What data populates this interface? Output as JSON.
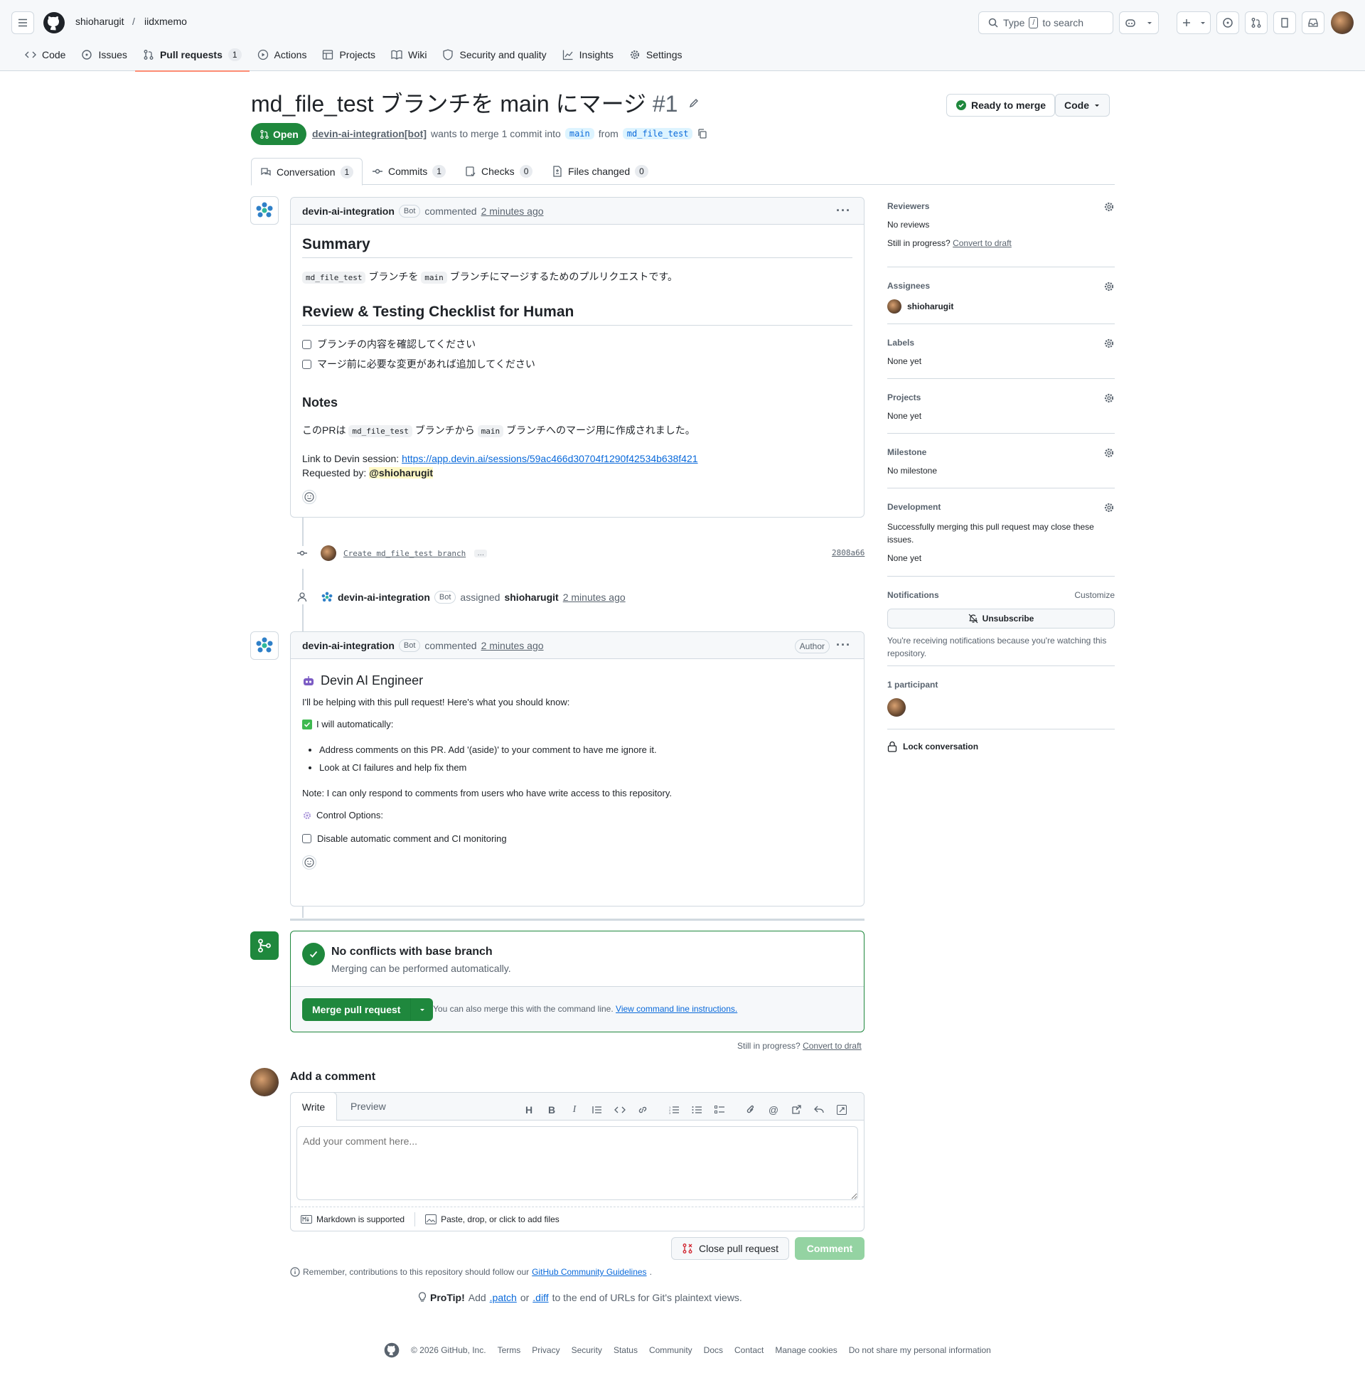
{
  "header": {
    "owner": "shioharugit",
    "separator": "/",
    "repo": "iidxmemo",
    "search_type": "Type",
    "search_key": "/",
    "search_rest": "to search"
  },
  "nav": [
    {
      "label": "Code",
      "icon": "code-icon"
    },
    {
      "label": "Issues",
      "icon": "issue-opened-icon"
    },
    {
      "label": "Pull requests",
      "icon": "git-pull-request-icon",
      "count": "1",
      "selected": true
    },
    {
      "label": "Actions",
      "icon": "play-icon"
    },
    {
      "label": "Projects",
      "icon": "table-icon"
    },
    {
      "label": "Wiki",
      "icon": "book-icon"
    },
    {
      "label": "Security and quality",
      "icon": "shield-icon"
    },
    {
      "label": "Insights",
      "icon": "graph-icon"
    },
    {
      "label": "Settings",
      "icon": "gear-icon"
    }
  ],
  "pr": {
    "title": "md_file_test ブランチを main にマージ",
    "number": "#1",
    "state": "Open",
    "author": "devin-ai-integration[bot]",
    "wants": "wants to merge 1 commit into",
    "base": "main",
    "from": "from",
    "head": "md_file_test",
    "ready": "Ready to merge",
    "code": "Code"
  },
  "tabs": [
    {
      "label": "Conversation",
      "count": "1"
    },
    {
      "label": "Commits",
      "count": "1"
    },
    {
      "label": "Checks",
      "count": "0"
    },
    {
      "label": "Files changed",
      "count": "0"
    }
  ],
  "c1": {
    "author": "devin-ai-integration",
    "bot": "Bot",
    "verb": "commented",
    "time": "2 minutes ago",
    "h_summary": "Summary",
    "code1": "md_file_test",
    "t1": "ブランチを",
    "code2": "main",
    "t2": "ブランチにマージするためのプルリクエストです。",
    "h_review": "Review & Testing Checklist for Human",
    "check1": "ブランチの内容を確認してください",
    "check2": "マージ前に必要な変更があれば追加してください",
    "h_notes": "Notes",
    "n1": "このPRは",
    "n_code1": "md_file_test",
    "n2": "ブランチから",
    "n_code2": "main",
    "n3": "ブランチへのマージ用に作成されました。",
    "link_label": "Link to Devin session:",
    "link": "https://app.devin.ai/sessions/59ac466d30704f1290f42534b638f421",
    "req_label": "Requested by:",
    "req_user": "@shioharugit"
  },
  "commit": {
    "msg": "Create md_file_test branch",
    "more": "…",
    "sha": "2808a66"
  },
  "assign": {
    "actor": "devin-ai-integration",
    "bot": "Bot",
    "verb": "assigned",
    "user": "shioharugit",
    "time": "2 minutes ago"
  },
  "c2": {
    "author": "devin-ai-integration",
    "bot": "Bot",
    "verb": "commented",
    "time": "2 minutes ago",
    "badge": "Author",
    "h": "Devin AI Engineer",
    "intro": "I'll be helping with this pull request! Here's what you should know:",
    "auto": "I will automatically:",
    "li1": "Address comments on this PR. Add '(aside)' to your comment to have me ignore it.",
    "li2": "Look at CI failures and help fix them",
    "note": "Note: I can only respond to comments from users who have write access to this repository.",
    "control": "Control Options:",
    "disable": "Disable automatic comment and CI monitoring"
  },
  "merge": {
    "title": "No conflicts with base branch",
    "sub": "Merging can be performed automatically.",
    "btn": "Merge pull request",
    "also": "You can also merge this with the command line.",
    "view": "View command line instructions.",
    "still": "Still in progress?",
    "convert": "Convert to draft"
  },
  "comment": {
    "title": "Add a comment",
    "write": "Write",
    "preview": "Preview",
    "placeholder": "Add your comment here...",
    "md": "Markdown is supported",
    "paste": "Paste, drop, or click to add files",
    "close": "Close pull request",
    "submit": "Comment",
    "remember": "Remember, contributions to this repository should follow our",
    "guide": "GitHub Community Guidelines",
    "dot": "."
  },
  "protip": {
    "label": "ProTip!",
    "t1": "Add",
    "patch": ".patch",
    "or": "or",
    "diff": ".diff",
    "t2": "to the end of URLs for Git's plaintext views."
  },
  "sidebar": {
    "reviewers": "Reviewers",
    "no_reviews": "No reviews",
    "still": "Still in progress?",
    "convert": "Convert to draft",
    "assignees": "Assignees",
    "assignee": "shioharugit",
    "labels": "Labels",
    "labels_v": "None yet",
    "projects": "Projects",
    "projects_v": "None yet",
    "milestone": "Milestone",
    "milestone_v": "No milestone",
    "development": "Development",
    "dev_text": "Successfully merging this pull request may close these issues.",
    "dev_v": "None yet",
    "notifications": "Notifications",
    "customize": "Customize",
    "unsubscribe": "Unsubscribe",
    "notif_text": "You're receiving notifications because you're watching this repository.",
    "participants": "1 participant",
    "lock": "Lock conversation"
  },
  "footer": {
    "copy": "© 2026 GitHub, Inc.",
    "links": [
      "Terms",
      "Privacy",
      "Security",
      "Status",
      "Community",
      "Docs",
      "Contact",
      "Manage cookies",
      "Do not share my personal information"
    ]
  },
  "colors": {
    "green": "#1f883d",
    "blue": "#0969da",
    "border": "#d1d9e0",
    "muted": "#59636e",
    "nav_underline": "#fd8c73"
  }
}
